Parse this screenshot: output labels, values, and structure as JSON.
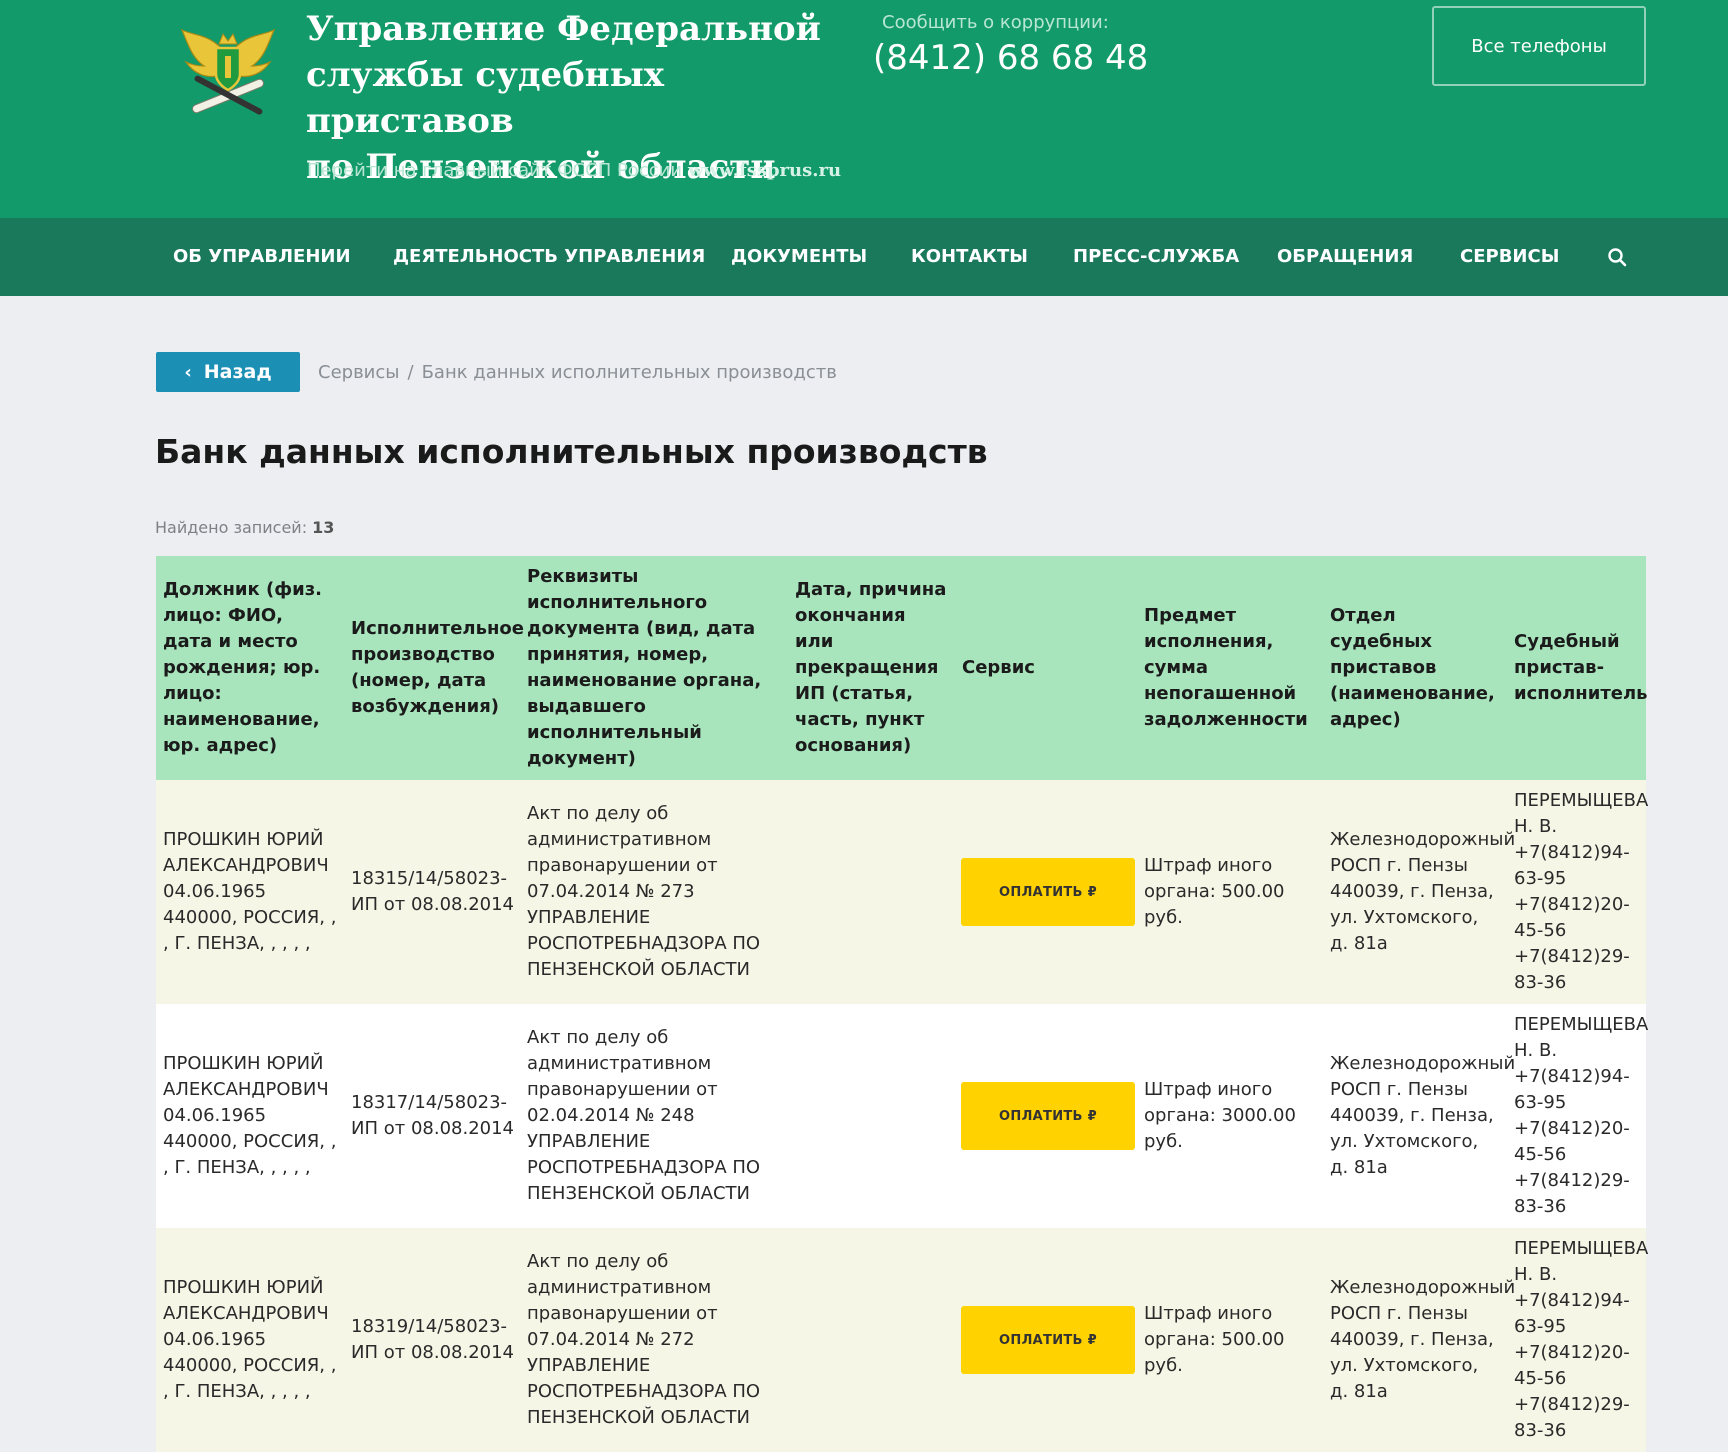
{
  "header": {
    "org_title_line1": "Управление Федеральной",
    "org_title_line2": "службы судебных приставов",
    "org_title_line3": "по Пензенской области",
    "main_site_label": "Перейти на главный сайт ФССП России",
    "main_site_url": "www.fssprus.ru",
    "corruption_label": "Сообщить о коррупции:",
    "corruption_phone": "(8412) 68 68 48",
    "all_phones_label": "Все телефоны"
  },
  "nav": {
    "items": [
      "ОБ УПРАВЛЕНИИ",
      "ДЕЯТЕЛЬНОСТЬ УПРАВЛЕНИЯ",
      "ДОКУМЕНТЫ",
      "КОНТАКТЫ",
      "ПРЕСС-СЛУЖБА",
      "ОБРАЩЕНИЯ",
      "СЕРВИСЫ"
    ]
  },
  "content": {
    "back_label": "Назад",
    "breadcrumb": [
      "Сервисы",
      "Банк данных исполнительных производств"
    ],
    "breadcrumb_sep": "/",
    "title": "Банк данных исполнительных производств",
    "found_label": "Найдено записей:",
    "found_count": "13"
  },
  "table": {
    "headers": [
      "Должник (физ. лицо: ФИО, дата и место рождения; юр. лицо: наименование, юр. адрес)",
      "Исполнительное производство (номер, дата возбуждения)",
      "Реквизиты исполнительного документа (вид, дата принятия, номер, наименование органа, выдавшего исполнительный документ)",
      "Дата, причина окончания или прекращения ИП (статья, часть, пункт основания)",
      "Сервис",
      "Предмет исполнения, сумма непогашенной задолженности",
      "Отдел судебных приставов (наименование, адрес)",
      "Судебный пристав-исполнитель"
    ],
    "pay_label": "ОПЛАТИТЬ ₽",
    "rows": [
      {
        "debtor": "ПРОШКИН ЮРИЙ АЛЕКСАНДРОВИЧ 04.06.1965 440000, РОССИЯ, , , Г. ПЕНЗА, , , , ,",
        "proceeding": "18315/14/58023-ИП от 08.08.2014",
        "document": "Акт по делу об административном правонарушении от 07.04.2014 № 273 УПРАВЛЕНИЕ РОСПОТРЕБНАДЗОРА ПО ПЕНЗЕНСКОЙ ОБЛАСТИ",
        "end_date": "",
        "subject": "Штраф иного органа: 500.00 руб.",
        "department": "Железнодорожный РОСП г. Пензы 440039, г. Пенза, ул. Ухтомского, д. 81а",
        "bailiff": "ПЕРЕМЫЩЕВА Н. В. +7(8412)94-63-95 +7(8412)20-45-56 +7(8412)29-83-36"
      },
      {
        "debtor": "ПРОШКИН ЮРИЙ АЛЕКСАНДРОВИЧ 04.06.1965 440000, РОССИЯ, , , Г. ПЕНЗА, , , , ,",
        "proceeding": "18317/14/58023-ИП от 08.08.2014",
        "document": "Акт по делу об административном правонарушении от 02.04.2014 № 248 УПРАВЛЕНИЕ РОСПОТРЕБНАДЗОРА ПО ПЕНЗЕНСКОЙ ОБЛАСТИ",
        "end_date": "",
        "subject": "Штраф иного органа: 3000.00 руб.",
        "department": "Железнодорожный РОСП г. Пензы 440039, г. Пенза, ул. Ухтомского, д. 81а",
        "bailiff": "ПЕРЕМЫЩЕВА Н. В. +7(8412)94-63-95 +7(8412)20-45-56 +7(8412)29-83-36"
      },
      {
        "debtor": "ПРОШКИН ЮРИЙ АЛЕКСАНДРОВИЧ 04.06.1965 440000, РОССИЯ, , , Г. ПЕНЗА, , , , ,",
        "proceeding": "18319/14/58023-ИП от 08.08.2014",
        "document": "Акт по делу об административном правонарушении от 07.04.2014 № 272 УПРАВЛЕНИЕ РОСПОТРЕБНАДЗОРА ПО ПЕНЗЕНСКОЙ ОБЛАСТИ",
        "end_date": "",
        "subject": "Штраф иного органа: 500.00 руб.",
        "department": "Железнодорожный РОСП г. Пензы 440039, г. Пенза, ул. Ухтомского, д. 81а",
        "bailiff": "ПЕРЕМЫЩЕВА Н. В. +7(8412)94-63-95 +7(8412)20-45-56 +7(8412)29-83-36"
      }
    ]
  },
  "colors": {
    "header_bg": "#139a6a",
    "nav_bg": "#19795a",
    "table_header_bg": "#a8e5bd",
    "pay_button": "#ffd200",
    "back_button": "#1c8fb5"
  },
  "icons": {
    "emblem": "fssp-emblem-icon",
    "search": "search-icon",
    "back": "chevron-left-icon"
  }
}
